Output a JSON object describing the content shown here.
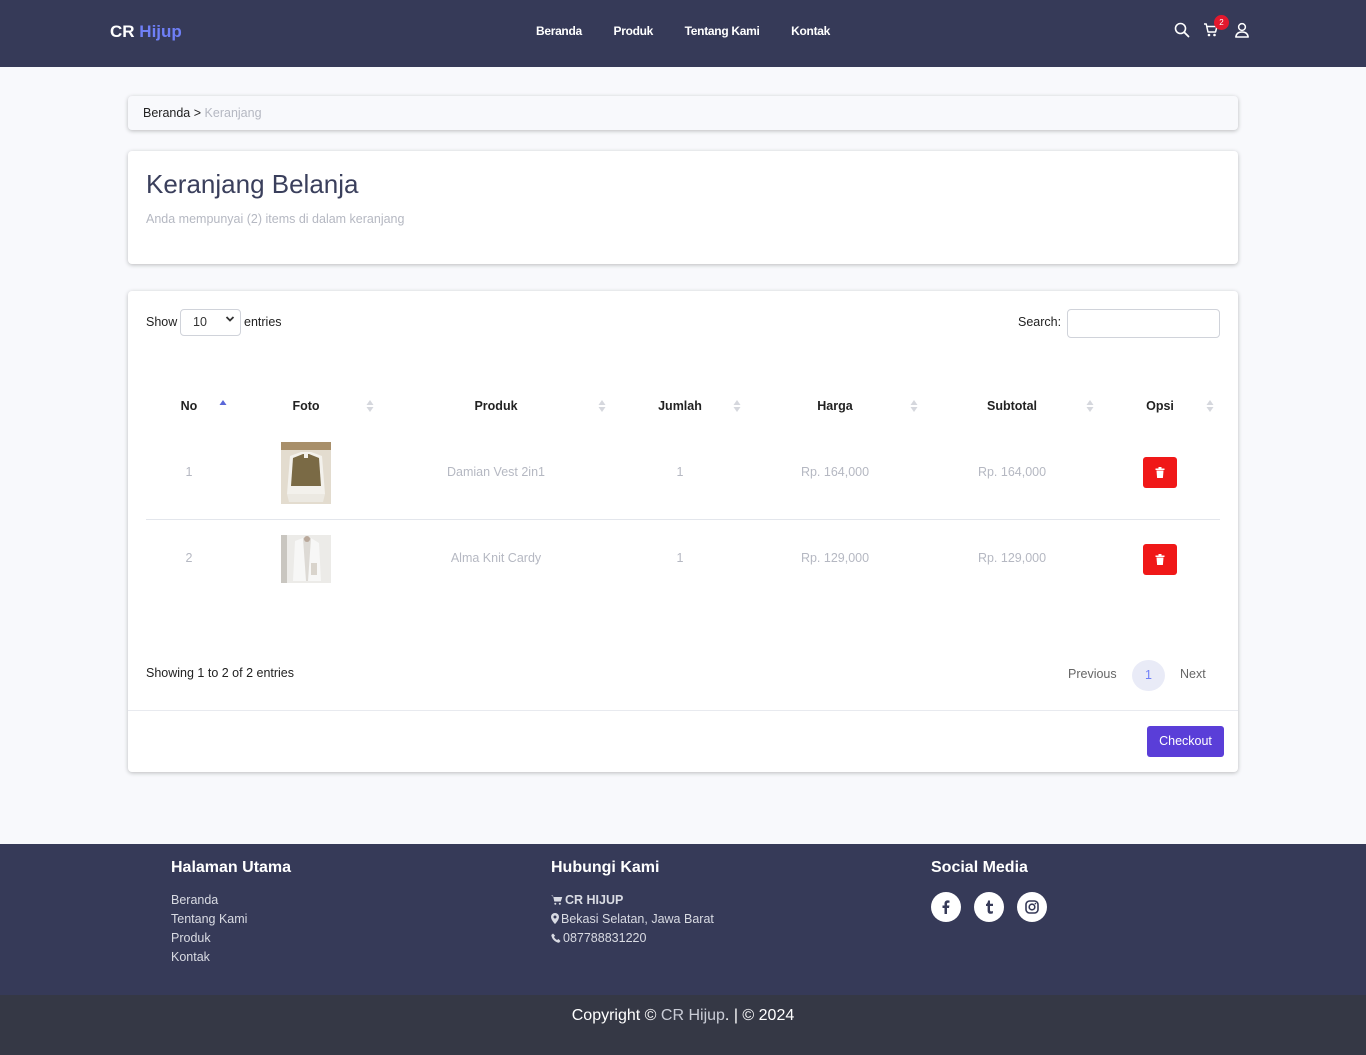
{
  "navbar": {
    "brand_first": "CR",
    "brand_second": "Hijup",
    "links": [
      "Beranda",
      "Produk",
      "Tentang Kami",
      "Kontak"
    ],
    "cart_count": "2",
    "icons": [
      "search-icon",
      "cart-icon",
      "user-icon"
    ]
  },
  "breadcrumb": {
    "home": "Beranda",
    "separator": ">",
    "current": "Keranjang"
  },
  "cart": {
    "title": "Keranjang Belanja",
    "subtitle": "Anda mempunyai (2) items di dalam keranjang"
  },
  "table": {
    "show_label": "Show",
    "entries_value": "10",
    "entries_label": "entries",
    "search_label": "Search:",
    "search_value": "",
    "columns": [
      "No",
      "Foto",
      "Produk",
      "Jumlah",
      "Harga",
      "Subtotal",
      "Opsi"
    ],
    "rows": [
      {
        "no": "1",
        "produk": "Damian Vest 2in1",
        "jumlah": "1",
        "harga": "Rp. 164,000",
        "subtotal": "Rp. 164,000"
      },
      {
        "no": "2",
        "produk": "Alma Knit Cardy",
        "jumlah": "1",
        "harga": "Rp. 129,000",
        "subtotal": "Rp. 129,000"
      }
    ],
    "showing_text": "Showing 1 to 2 of 2 entries",
    "pagination": {
      "previous": "Previous",
      "page": "1",
      "next": "Next"
    },
    "checkout_label": "Checkout"
  },
  "footer": {
    "col1": {
      "heading": "Halaman Utama",
      "links": [
        "Beranda",
        "Tentang Kami",
        "Produk",
        "Kontak"
      ]
    },
    "col2": {
      "heading": "Hubungi Kami",
      "company": "CR HIJUP",
      "address": "Bekasi Selatan, Jawa Barat",
      "phone": "087788831220"
    },
    "col3": {
      "heading": "Social Media",
      "icons": [
        "facebook-icon",
        "tumblr-icon",
        "instagram-icon"
      ]
    },
    "copyright_prefix": "Copyright ©",
    "copyright_brand": "CR Hijup",
    "copyright_suffix": ". | © 2024"
  },
  "colors": {
    "navbar": "#363a58",
    "brand_accent": "#6f7ff7",
    "delete": "#f01818",
    "checkout": "#5a3ed8",
    "badge": "#e3182d"
  }
}
